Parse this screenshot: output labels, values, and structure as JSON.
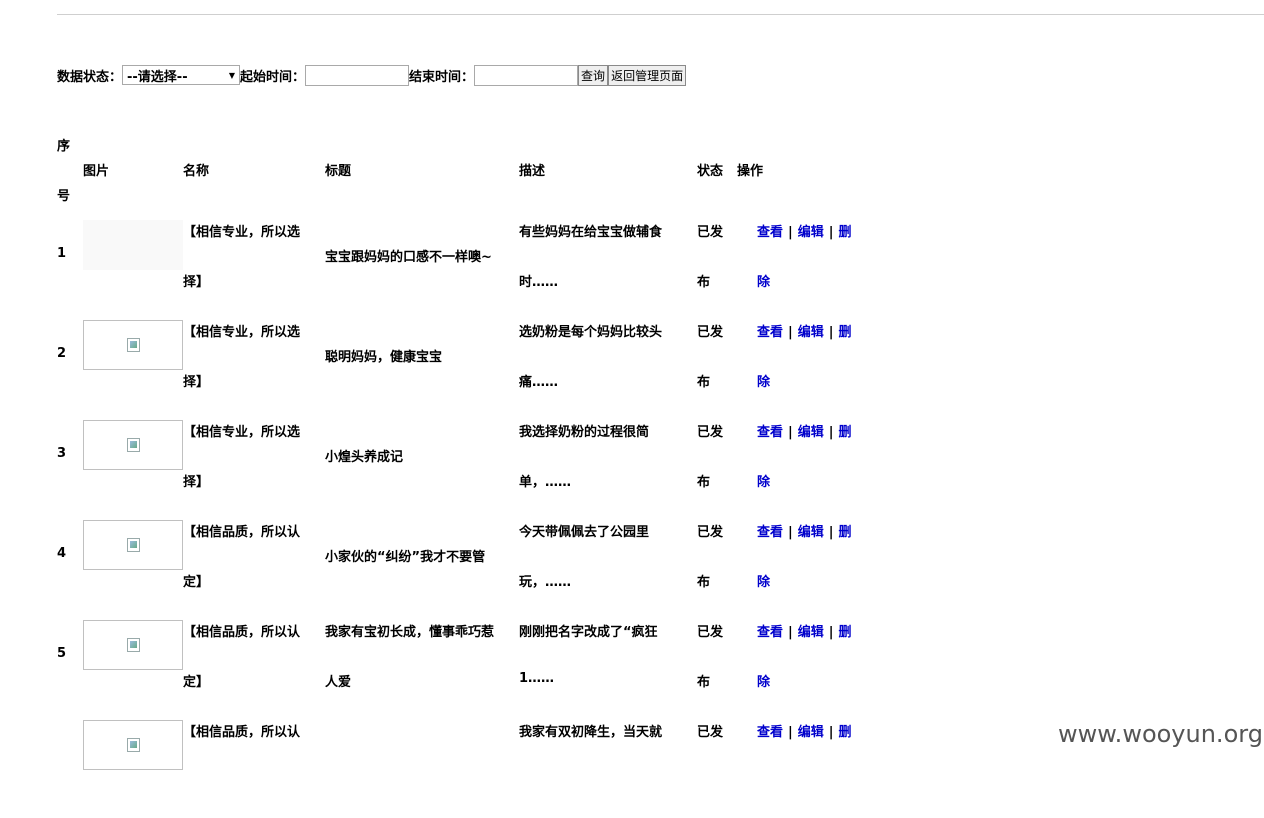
{
  "filter": {
    "status_label": "数据状态：",
    "status_selected": "--请选择--",
    "start_label": "起始时间：",
    "start_value": "",
    "end_label": "结束时间：",
    "end_value": "",
    "query_button": "查询",
    "back_button": "返回管理页面"
  },
  "table": {
    "headers": {
      "index_line1": "序",
      "index_line2": "号",
      "image": "图片",
      "name": "名称",
      "title": "标题",
      "desc": "描述",
      "status": "状态",
      "action": "操作"
    },
    "rows": [
      {
        "index": "1",
        "name_l1": "【相信专业，所以选",
        "name_l2": "择】",
        "title": "宝宝跟妈妈的口感不一样噢~",
        "title_l2": "",
        "desc_l1": "有些妈妈在给宝宝做辅食",
        "desc_l2": "时……",
        "status_l1": "已发",
        "status_l2": "布",
        "view": "查看",
        "edit": "编辑",
        "del_l1": "删",
        "del_l2": "除"
      },
      {
        "index": "2",
        "name_l1": "【相信专业，所以选",
        "name_l2": "择】",
        "title": "聪明妈妈，健康宝宝",
        "title_l2": "",
        "desc_l1": "选奶粉是每个妈妈比较头",
        "desc_l2": "痛……",
        "status_l1": "已发",
        "status_l2": "布",
        "view": "查看",
        "edit": "编辑",
        "del_l1": "删",
        "del_l2": "除"
      },
      {
        "index": "3",
        "name_l1": "【相信专业，所以选",
        "name_l2": "择】",
        "title": "小煌头养成记",
        "title_l2": "",
        "desc_l1": "我选择奶粉的过程很简",
        "desc_l2": "单，……",
        "status_l1": "已发",
        "status_l2": "布",
        "view": "查看",
        "edit": "编辑",
        "del_l1": "删",
        "del_l2": "除"
      },
      {
        "index": "4",
        "name_l1": "【相信品质，所以认",
        "name_l2": "定】",
        "title": "小家伙的“纠纷”我才不要管",
        "title_l2": "",
        "desc_l1": "今天带佩佩去了公园里",
        "desc_l2": "玩，……",
        "status_l1": "已发",
        "status_l2": "布",
        "view": "查看",
        "edit": "编辑",
        "del_l1": "删",
        "del_l2": "除"
      },
      {
        "index": "5",
        "name_l1": "【相信品质，所以认",
        "name_l2": "定】",
        "title": "我家有宝初长成，懂事乖巧惹",
        "title_l2": "人爱",
        "desc_l1": "刚刚把名字改成了“疯狂",
        "desc_l2": "1……",
        "status_l1": "已发",
        "status_l2": "布",
        "view": "查看",
        "edit": "编辑",
        "del_l1": "删",
        "del_l2": "除"
      },
      {
        "index": "",
        "name_l1": "【相信品质，所以认",
        "name_l2": "",
        "title": "",
        "title_l2": "",
        "desc_l1": "我家有双初降生，当天就",
        "desc_l2": "",
        "status_l1": "已发",
        "status_l2": "",
        "view": "查看",
        "edit": "编辑",
        "del_l1": "删",
        "del_l2": ""
      }
    ]
  },
  "watermark": "www.wooyun.org",
  "colors": {
    "link": "#0000cc",
    "divider": "#cfcfcf"
  }
}
